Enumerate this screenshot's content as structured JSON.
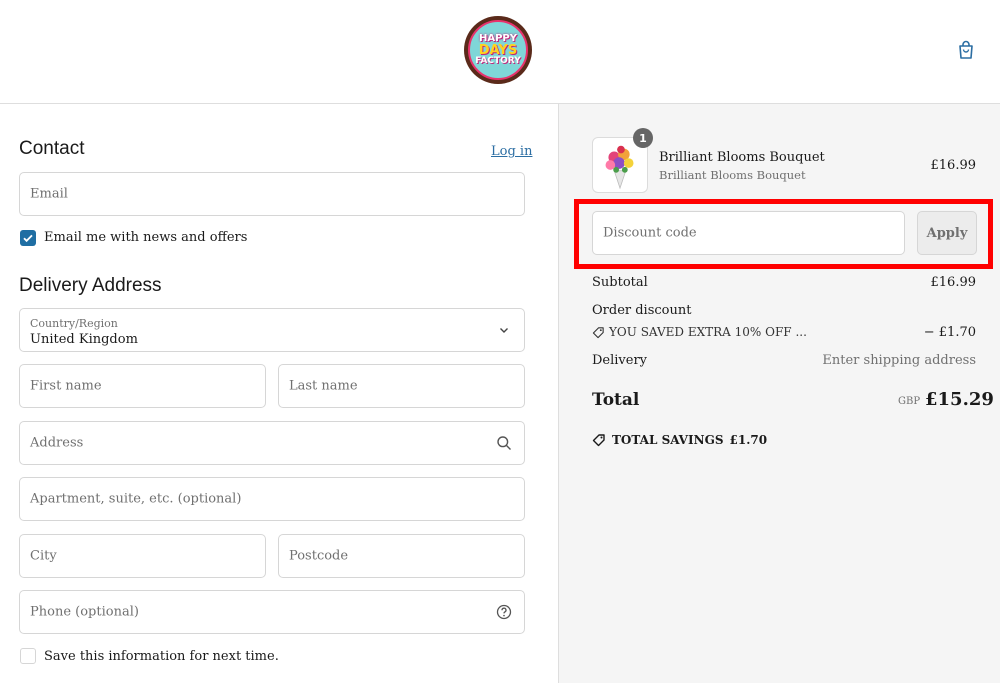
{
  "header": {
    "logo": {
      "line1": "HAPPY",
      "line2": "DAYS",
      "line3": "FACTORY"
    },
    "cart_icon": "shopping-bag-icon"
  },
  "contact": {
    "title": "Contact",
    "login_link": "Log in",
    "email_placeholder": "Email",
    "newsletter_label": "Email me with news and offers",
    "newsletter_checked": true
  },
  "delivery": {
    "title": "Delivery Address",
    "country_label": "Country/Region",
    "country_value": "United Kingdom",
    "first_name_placeholder": "First name",
    "last_name_placeholder": "Last name",
    "address_placeholder": "Address",
    "apartment_placeholder": "Apartment, suite, etc. (optional)",
    "city_placeholder": "City",
    "postcode_placeholder": "Postcode",
    "phone_placeholder": "Phone (optional)",
    "save_info_label": "Save this information for next time.",
    "save_info_checked": false
  },
  "summary": {
    "item": {
      "name": "Brilliant Blooms Bouquet",
      "variant": "Brilliant Blooms Bouquet",
      "price": "£16.99",
      "quantity": "1"
    },
    "discount_placeholder": "Discount code",
    "apply_label": "Apply",
    "subtotal_label": "Subtotal",
    "subtotal_value": "£16.99",
    "order_discount_label": "Order discount",
    "discount_code_label": "YOU SAVED EXTRA 10% OFF ...",
    "discount_value": "− £1.70",
    "delivery_label": "Delivery",
    "delivery_value": "Enter shipping address",
    "total_label": "Total",
    "total_currency": "GBP",
    "total_value": "£15.29",
    "total_savings_label": "TOTAL SAVINGS",
    "total_savings_value": "£1.70"
  },
  "colors": {
    "accent": "#1f6ea3",
    "link": "#2c6ea3",
    "highlight": "#ff0000",
    "summary_bg": "#f5f5f5"
  }
}
